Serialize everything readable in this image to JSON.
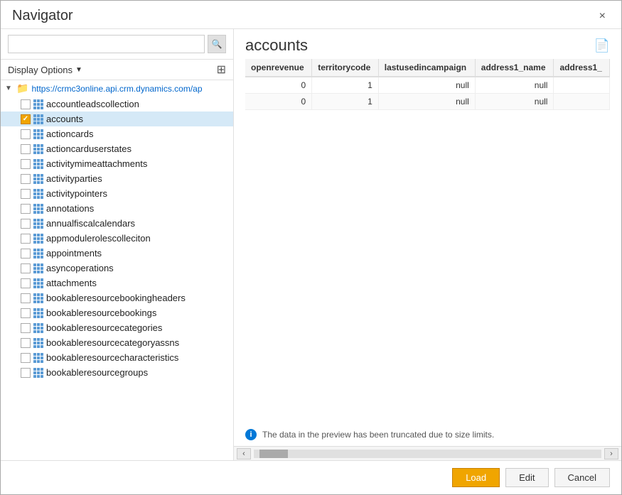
{
  "dialog": {
    "title": "Navigator",
    "close_label": "×"
  },
  "search": {
    "placeholder": "",
    "search_icon": "🔍"
  },
  "toolbar": {
    "display_options_label": "Display Options",
    "dropdown_icon": "▼",
    "grid_icon": "⊞"
  },
  "tree": {
    "root_url": "https://crmc3online.api.crm.dynamics.com/ap",
    "items": [
      {
        "id": "accountleadscollection",
        "label": "accountleadscollection",
        "checked": false,
        "selected": false
      },
      {
        "id": "accounts",
        "label": "accounts",
        "checked": true,
        "selected": true
      },
      {
        "id": "actioncards",
        "label": "actioncards",
        "checked": false,
        "selected": false
      },
      {
        "id": "actioncarduserstates",
        "label": "actioncarduserstates",
        "checked": false,
        "selected": false
      },
      {
        "id": "activitymimeattachments",
        "label": "activitymimeattachments",
        "checked": false,
        "selected": false
      },
      {
        "id": "activityparties",
        "label": "activityparties",
        "checked": false,
        "selected": false
      },
      {
        "id": "activitypointers",
        "label": "activitypointers",
        "checked": false,
        "selected": false
      },
      {
        "id": "annotations",
        "label": "annotations",
        "checked": false,
        "selected": false
      },
      {
        "id": "annualfiscalcalendars",
        "label": "annualfiscalcalendars",
        "checked": false,
        "selected": false
      },
      {
        "id": "appmodulerolescolleciton",
        "label": "appmodulerolescolleciton",
        "checked": false,
        "selected": false
      },
      {
        "id": "appointments",
        "label": "appointments",
        "checked": false,
        "selected": false
      },
      {
        "id": "asyncoperations",
        "label": "asyncoperations",
        "checked": false,
        "selected": false
      },
      {
        "id": "attachments",
        "label": "attachments",
        "checked": false,
        "selected": false
      },
      {
        "id": "bookableresourcebookingheaders",
        "label": "bookableresourcebookingheaders",
        "checked": false,
        "selected": false
      },
      {
        "id": "bookableresourcebookings",
        "label": "bookableresourcebookings",
        "checked": false,
        "selected": false
      },
      {
        "id": "bookableresourcecategories",
        "label": "bookableresourcecategories",
        "checked": false,
        "selected": false
      },
      {
        "id": "bookableresourcecategoryassns",
        "label": "bookableresourcecategoryassns",
        "checked": false,
        "selected": false
      },
      {
        "id": "bookableresourcecharacteristics",
        "label": "bookableresourcecharacteristics",
        "checked": false,
        "selected": false
      },
      {
        "id": "bookableresourcegroups",
        "label": "bookableresourcegroups",
        "checked": false,
        "selected": false
      }
    ]
  },
  "right_panel": {
    "title": "accounts",
    "preview_icon": "📄",
    "table": {
      "columns": [
        "openrevenue",
        "territorycode",
        "lastusedincampaign",
        "address1_name",
        "address1_"
      ],
      "rows": [
        [
          "0",
          "1",
          "null",
          "null",
          ""
        ],
        [
          "0",
          "1",
          "null",
          "null",
          ""
        ]
      ]
    },
    "info_message": "The data in the preview has been truncated due to size limits."
  },
  "footer": {
    "load_label": "Load",
    "edit_label": "Edit",
    "cancel_label": "Cancel"
  }
}
